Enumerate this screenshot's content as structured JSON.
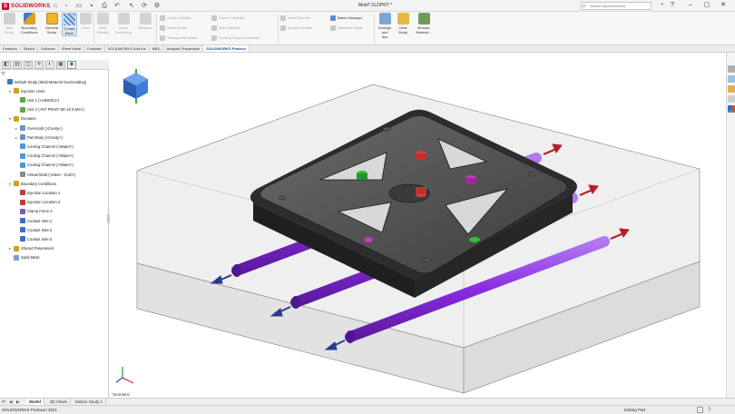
{
  "app": {
    "logo_text": "SOLIDWORKS",
    "document_title": "Mold*.SLDPRT *",
    "search_placeholder": "Search MySolidWorks"
  },
  "ribbon": {
    "main_buttons": [
      {
        "label": "New\nStudy",
        "icon": "new-study-icon",
        "enabled": false
      },
      {
        "label": "Boundary\nConditions",
        "icon": "boundary-conditions-icon",
        "enabled": true
      },
      {
        "label": "General\nSetup",
        "icon": "general-setup-icon",
        "enabled": true
      },
      {
        "label": "Create\nMesh",
        "icon": "create-mesh-icon",
        "enabled": true
      },
      {
        "label": "Flow",
        "icon": "flow-icon",
        "enabled": false
      },
      {
        "label": "View\nResults",
        "icon": "view-results-icon",
        "enabled": false
      },
      {
        "label": "Video\nRecording",
        "icon": "video-recording-icon",
        "enabled": false
      },
      {
        "label": "Measure",
        "icon": "measure-icon",
        "enabled": false
      }
    ],
    "small_buttons": [
      {
        "label": "Cavity Visibility",
        "enabled": false
      },
      {
        "label": "Mesh Model",
        "enabled": false
      },
      {
        "label": "Transparent Model",
        "enabled": false
      },
      {
        "label": "Runner Visibility",
        "enabled": false
      },
      {
        "label": "Mold Visibility",
        "enabled": false
      },
      {
        "label": "Cooling Channel Visibility",
        "enabled": false
      },
      {
        "label": "Insert Domain",
        "enabled": false
      },
      {
        "label": "Assign Domain",
        "enabled": false
      },
      {
        "label": "Batch Manager",
        "enabled": true
      },
      {
        "label": "Duplicate Study",
        "enabled": false
      }
    ],
    "right_buttons": [
      {
        "label": "Settings\nand\nInfo",
        "icon": "settings-info-icon"
      },
      {
        "label": "Clear\nStudy",
        "icon": "clear-study-icon"
      },
      {
        "label": "Browse\nMaterial...",
        "icon": "browse-material-icon"
      }
    ]
  },
  "command_tabs": [
    {
      "label": "Features",
      "active": false
    },
    {
      "label": "Sketch",
      "active": false
    },
    {
      "label": "Surfaces",
      "active": false
    },
    {
      "label": "Sheet Metal",
      "active": false
    },
    {
      "label": "Evaluate",
      "active": false
    },
    {
      "label": "SOLIDWORKS Add-Ins",
      "active": false
    },
    {
      "label": "MBD",
      "active": false
    },
    {
      "label": "Analysis Preparation",
      "active": false
    },
    {
      "label": "SOLIDWORKS Plastics",
      "active": true
    }
  ],
  "tree": {
    "items": [
      {
        "level": 0,
        "label": "Default Study (Multi-Material Overmolding)",
        "expand": "",
        "color": "#3b78c2"
      },
      {
        "level": 1,
        "label": "Injection Units",
        "expand": "▾",
        "color": "#d4a017"
      },
      {
        "level": 2,
        "label": "Unit 1 (>ABS001<)",
        "expand": "",
        "color": "#5aa846"
      },
      {
        "level": 2,
        "label": "Unit 2 (>NT PRINT NE 10 5 MS<)",
        "expand": "",
        "color": "#5aa846"
      },
      {
        "level": 1,
        "label": "Domains",
        "expand": "▾",
        "color": "#d4a017"
      },
      {
        "level": 2,
        "label": "Overmold (>Cavity<)",
        "expand": "▸",
        "color": "#6d8fc4"
      },
      {
        "level": 2,
        "label": "Part Body (>Cavity<)",
        "expand": "▸",
        "color": "#6d8fc4"
      },
      {
        "level": 2,
        "label": "Cooling Channel (>Water<)",
        "expand": "",
        "color": "#4a9ad6"
      },
      {
        "level": 2,
        "label": "Cooling Channel (>Water<)",
        "expand": "",
        "color": "#4a9ad6"
      },
      {
        "level": 2,
        "label": "Cooling Channel (>Water<)",
        "expand": "",
        "color": "#4a9ad6"
      },
      {
        "level": 2,
        "label": "Virtual Mold (>Steel - 4130<)",
        "expand": "",
        "color": "#8a8a8a"
      },
      {
        "level": 1,
        "label": "Boundary Conditions",
        "expand": "▾",
        "color": "#d4a017"
      },
      {
        "level": 2,
        "label": "Injection Location-1",
        "expand": "",
        "color": "#c43b3b"
      },
      {
        "level": 2,
        "label": "Injection Location-2",
        "expand": "",
        "color": "#c43b3b"
      },
      {
        "level": 2,
        "label": "Clamp Force-1",
        "expand": "",
        "color": "#7a5fb3"
      },
      {
        "level": 2,
        "label": "Coolant Inlet-1",
        "expand": "",
        "color": "#3b6fc4"
      },
      {
        "level": 2,
        "label": "Coolant Inlet-2",
        "expand": "",
        "color": "#3b6fc4"
      },
      {
        "level": 2,
        "label": "Coolant Inlet-3",
        "expand": "",
        "color": "#3b6fc4"
      },
      {
        "level": 1,
        "label": "Shared Parameters",
        "expand": "▸",
        "color": "#d4a017"
      },
      {
        "level": 1,
        "label": "Solid Mesh",
        "expand": "",
        "color": "#7a9fd0"
      }
    ]
  },
  "viewport": {
    "view_name": "*Isometric"
  },
  "bottom_tabs": [
    {
      "label": "Model",
      "active": true
    },
    {
      "label": "3D Views",
      "active": false
    },
    {
      "label": "Motion Study 1",
      "active": false
    }
  ],
  "status": {
    "left": "SOLIDWORKS Premium 2021",
    "right": "Editing Part"
  },
  "colors": {
    "part": "#4a4a4a",
    "mold_box": "#e6e6e6",
    "cooling_channel": "#8a2be2",
    "inlet_arrow": "#2a3b8f",
    "outlet_arrow": "#b3202a",
    "injection_red": "#e03c3c",
    "injection_green": "#2fbf3a",
    "injection_magenta": "#c23bc2"
  }
}
